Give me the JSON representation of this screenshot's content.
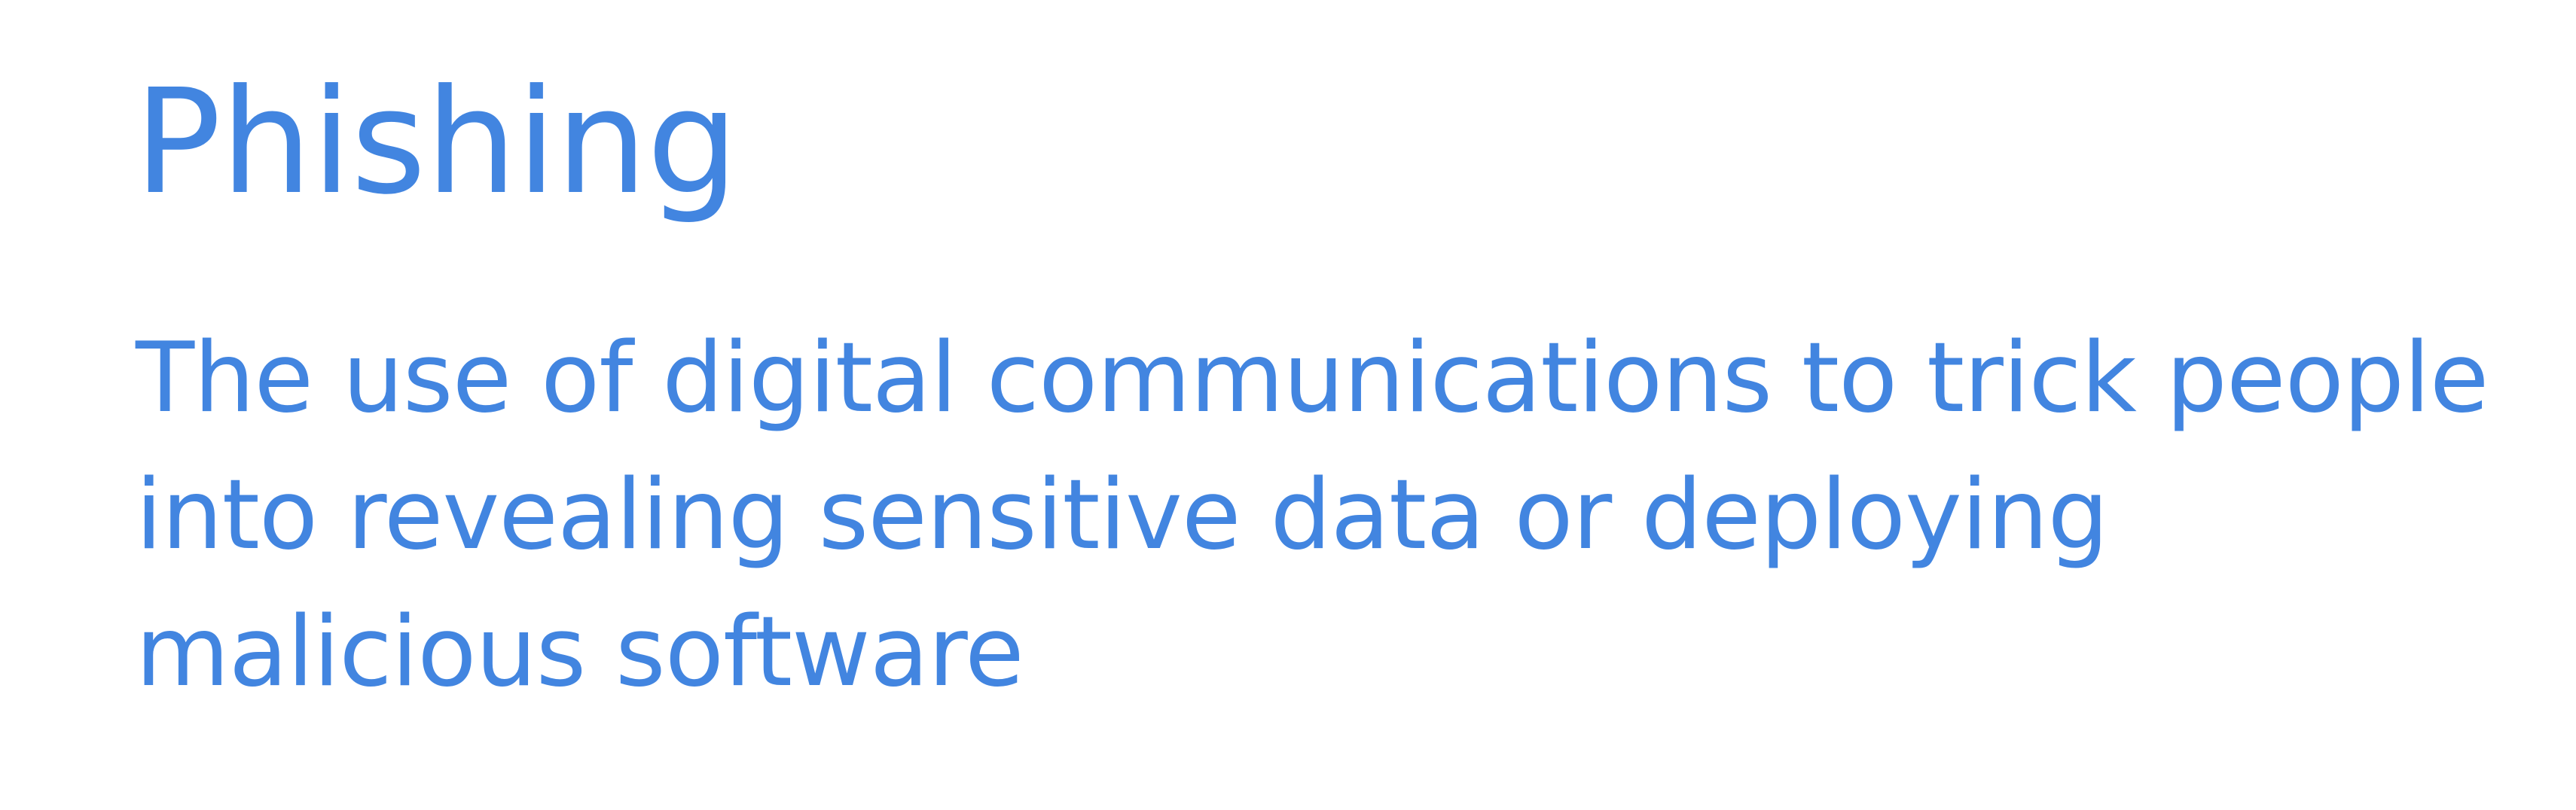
{
  "slide": {
    "title": "Phishing",
    "definition_lines": [
      "The use of digital communications to trick people",
      "into revealing sensitive data or deploying",
      "malicious software"
    ],
    "colors": {
      "text": "#4285e0",
      "background": "#ffffff"
    }
  }
}
